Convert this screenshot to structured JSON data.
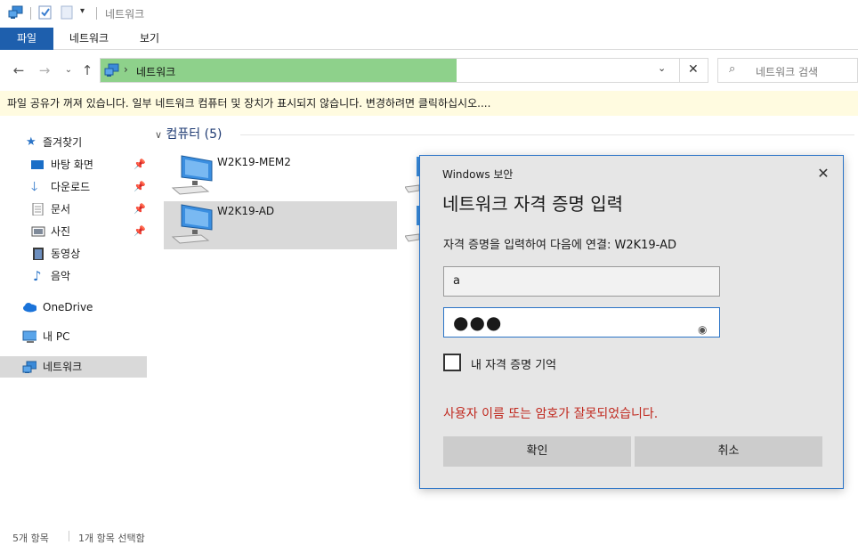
{
  "window": {
    "title": "네트워크"
  },
  "ribbon": {
    "tabs": [
      {
        "label": "파일",
        "active": true
      },
      {
        "label": "네트워크",
        "active": false
      },
      {
        "label": "보기",
        "active": false
      }
    ]
  },
  "address": {
    "crumb": "네트워크",
    "search_placeholder": "네트워크 검색"
  },
  "infobar": {
    "text": "파일 공유가 꺼져 있습니다. 일부 네트워크 컴퓨터 및 장치가 표시되지 않습니다. 변경하려면 클릭하십시오...."
  },
  "navpane": {
    "quick_access": "즐겨찾기",
    "items": [
      {
        "label": "바탕 화면",
        "icon": "desktop-icon",
        "pinned": true
      },
      {
        "label": "다운로드",
        "icon": "download-icon",
        "pinned": true
      },
      {
        "label": "문서",
        "icon": "document-icon",
        "pinned": true
      },
      {
        "label": "사진",
        "icon": "pictures-icon",
        "pinned": true
      },
      {
        "label": "동영상",
        "icon": "video-icon",
        "pinned": false
      },
      {
        "label": "음악",
        "icon": "music-icon",
        "pinned": false
      }
    ],
    "onedrive": "OneDrive",
    "thispc": "내 PC",
    "network": "네트워크"
  },
  "content": {
    "group_label": "컴퓨터 (5)",
    "computers": [
      {
        "name": "W2K19-MEM2",
        "selected": false
      },
      {
        "name": "W2K19-AD",
        "selected": true
      }
    ]
  },
  "status": {
    "items": "5개 항목",
    "selected": "1개 항목 선택함"
  },
  "dialog": {
    "window_title": "Windows 보안",
    "heading": "네트워크 자격 증명 입력",
    "prompt": "자격 증명을 입력하여 다음에 연결: W2K19-AD",
    "username_value": "a",
    "password_mask": "●●●",
    "remember_label": "내 자격 증명 기억",
    "remember_checked": false,
    "error": "사용자 이름 또는 암호가 잘못되었습니다.",
    "ok_label": "확인",
    "cancel_label": "취소"
  },
  "colors": {
    "accent": "#1e5fad",
    "address_fill": "#8ed18b",
    "infobar_bg": "#fffbe0",
    "error": "#c0281e",
    "dialog_border": "#2b74c7"
  }
}
